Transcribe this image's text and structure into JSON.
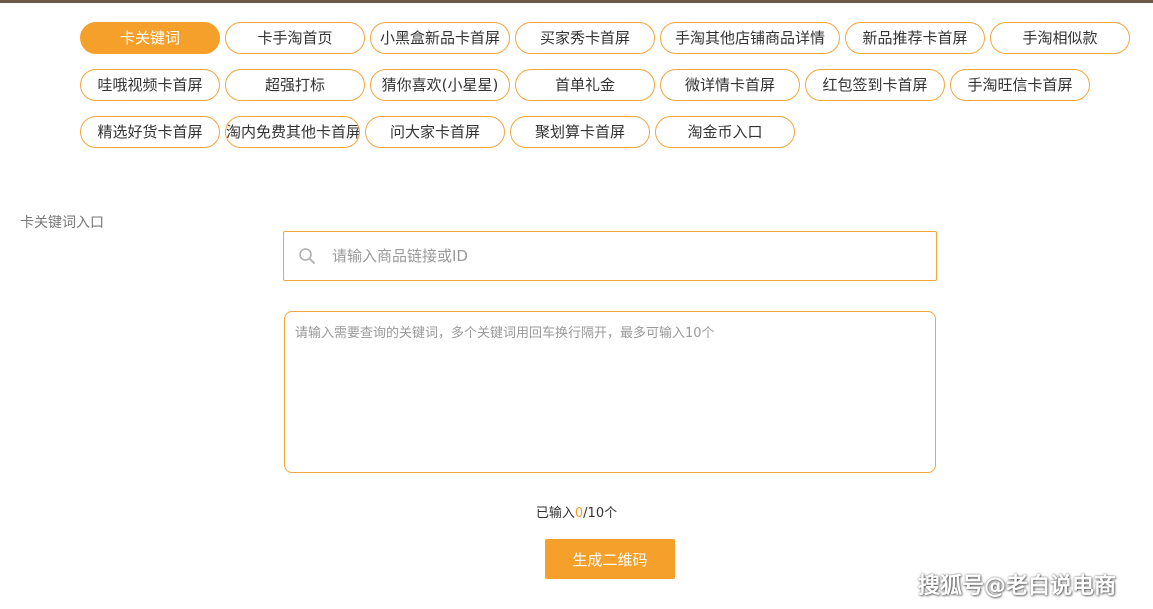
{
  "tabs": {
    "row1": [
      "卡关键词",
      "卡手淘首页",
      "小黑盒新品卡首屏",
      "买家秀卡首屏",
      "手淘其他店铺商品详情",
      "新品推荐卡首屏",
      "手淘相似款"
    ],
    "row2": [
      "哇哦视频卡首屏",
      "超强打标",
      "猜你喜欢(小星星)",
      "首单礼金",
      "微详情卡首屏",
      "红包签到卡首屏",
      "手淘旺信卡首屏"
    ],
    "row3": [
      "精选好货卡首屏",
      "淘内免费其他卡首屏",
      "问大家卡首屏",
      "聚划算卡首屏",
      "淘金币入口"
    ],
    "active": "卡关键词"
  },
  "form": {
    "section_label": "卡关键词入口",
    "search_placeholder": "请输入商品链接或ID",
    "keywords_placeholder": "请输入需要查询的关键词，多个关键词用回车换行隔开，最多可输入10个",
    "counter_prefix": "已输入",
    "counter_current": "0",
    "counter_suffix": "/10个",
    "generate_label": "生成二维码"
  },
  "watermark": {
    "text": "搜狐号@老白说电商"
  },
  "colors": {
    "accent": "#f5a02b",
    "border": "#f5a53c"
  },
  "icons": {
    "search": "search-icon"
  }
}
